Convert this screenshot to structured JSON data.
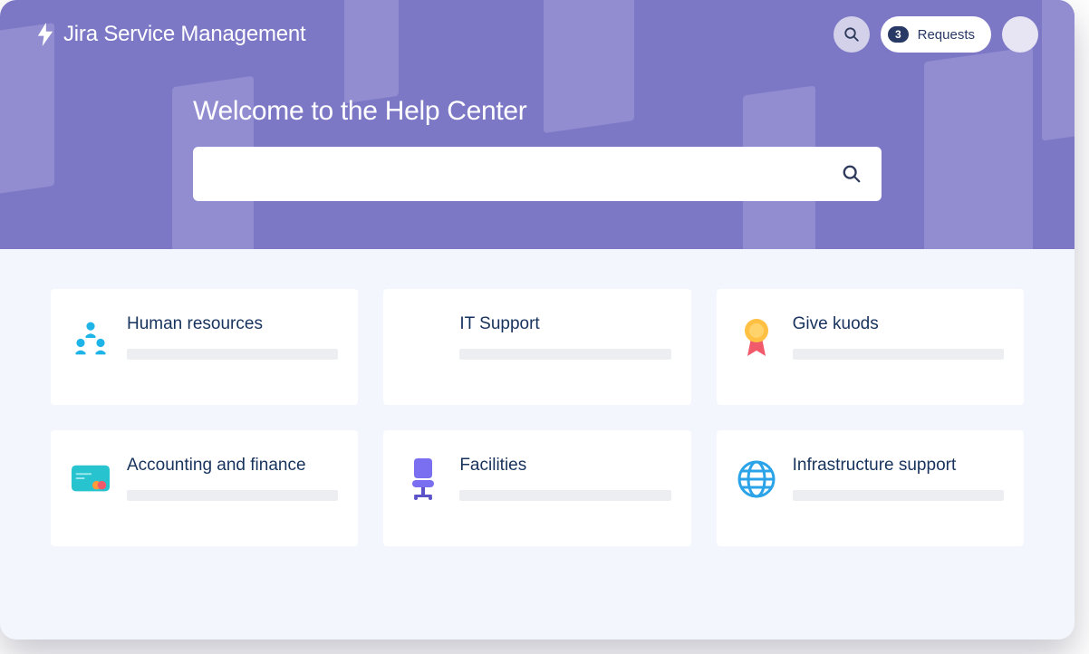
{
  "brand": {
    "name": "Jira Service Management"
  },
  "topbar": {
    "requests_badge": "3",
    "requests_label": "Requests"
  },
  "hero": {
    "title": "Welcome to the Help Center"
  },
  "search": {
    "placeholder": ""
  },
  "cards": [
    {
      "title": "Human resources",
      "icon": "people"
    },
    {
      "title": "IT Support",
      "icon": "none"
    },
    {
      "title": "Give kuods",
      "icon": "award"
    },
    {
      "title": "Accounting and finance",
      "icon": "creditcard"
    },
    {
      "title": "Facilities",
      "icon": "chair"
    },
    {
      "title": "Infrastructure support",
      "icon": "globe"
    }
  ]
}
